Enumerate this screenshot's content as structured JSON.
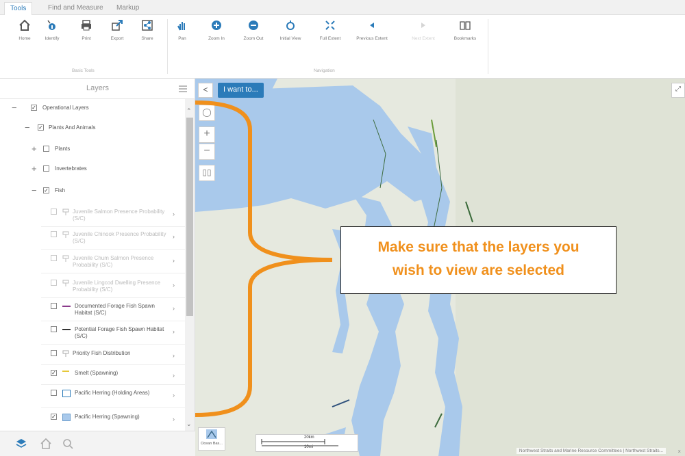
{
  "tabs": [
    "Tools",
    "Find and Measure",
    "Markup"
  ],
  "tools_basic": [
    {
      "label": "Home",
      "icon": "home-icon"
    },
    {
      "label": "Identify",
      "icon": "identify-icon"
    },
    {
      "label": "Print",
      "icon": "print-icon"
    },
    {
      "label": "Export",
      "icon": "export-icon"
    },
    {
      "label": "Share",
      "icon": "share-icon"
    }
  ],
  "tools_nav": [
    {
      "label": "Pan",
      "icon": "pan-icon"
    },
    {
      "label": "Zoom In",
      "icon": "zoom-in-icon"
    },
    {
      "label": "Zoom Out",
      "icon": "zoom-out-icon"
    },
    {
      "label": "Initial View",
      "icon": "initial-view-icon"
    },
    {
      "label": "Full Extent",
      "icon": "full-extent-icon"
    },
    {
      "label": "Previous Extent",
      "icon": "previous-extent-icon"
    },
    {
      "label": "Next Extent",
      "icon": "next-extent-icon"
    },
    {
      "label": "Bookmarks",
      "icon": "bookmarks-icon"
    }
  ],
  "groups": {
    "basic": "Basic Tools",
    "nav": "Navigation"
  },
  "panel": {
    "title": "Layers"
  },
  "layers": [
    {
      "label": "Operational Layers",
      "checked": true,
      "toggle": "−"
    },
    {
      "label": "Plants And Animals",
      "checked": true,
      "toggle": "−"
    },
    {
      "label": "Plants",
      "checked": false,
      "toggle": "+"
    },
    {
      "label": "Invertebrates",
      "checked": false,
      "toggle": "+"
    },
    {
      "label": "Fish",
      "checked": true,
      "toggle": "−"
    },
    {
      "label": "Juvenile Salmon Presence Probability (S/C)",
      "checked": false,
      "symbol": "grid-symbol-icon",
      "dim": true
    },
    {
      "label": "Juvenile Chinook Presence Probability (S/C)",
      "checked": false,
      "symbol": "grid-symbol-icon",
      "dim": true
    },
    {
      "label": "Juvenile Chum Salmon Presence Probability (S/C)",
      "checked": false,
      "symbol": "grid-symbol-icon",
      "dim": true
    },
    {
      "label": "Juvenile Lingcod Dwelling Presence Probability (S/C)",
      "checked": false,
      "symbol": "grid-symbol-icon",
      "dim": true
    },
    {
      "label": "Documented Forage Fish Spawn Habitat (S/C)",
      "checked": false,
      "symbol": "purple-line-symbol"
    },
    {
      "label": "Potential Forage Fish Spawn Habitat (S/C)",
      "checked": false,
      "symbol": "dark-line-symbol"
    },
    {
      "label": "Priority Fish Distribution",
      "checked": false,
      "symbol": "grid-symbol-icon"
    },
    {
      "label": "Smelt (Spawning)",
      "checked": true,
      "symbol": "yellow-line-symbol"
    },
    {
      "label": "Pacific Herring (Holding Areas)",
      "checked": false,
      "symbol": "outline-square-symbol"
    },
    {
      "label": "Pacific Herring (Spawning)",
      "checked": true,
      "symbol": "filled-square-symbol"
    }
  ],
  "map": {
    "i_want_to": "I want to...",
    "back": "<",
    "basemap_label": "Ocean Bas...",
    "scale_top": "20km",
    "scale_bottom": "10mi",
    "attribution": "Northwest Straits and Marine Resource Committees | Northwest Straits...",
    "callout_line1": "Make sure that the layers you",
    "callout_line2": "wish to view are selected",
    "colors": {
      "water": "#a9c9eb",
      "land": "#e4e8dd",
      "accent": "#f0901c",
      "button": "#2b7bb9"
    }
  }
}
